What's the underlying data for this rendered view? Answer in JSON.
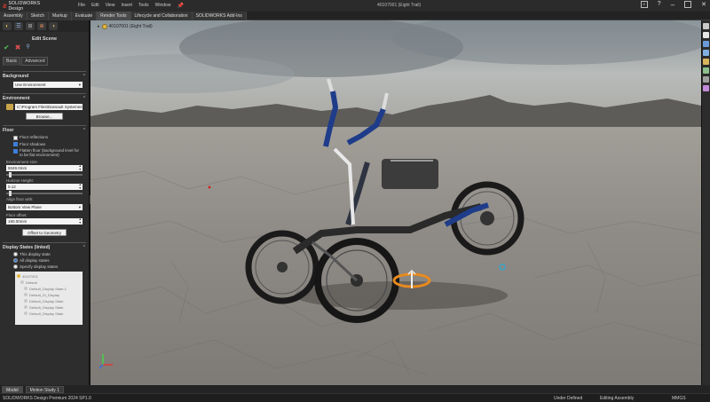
{
  "titlebar": {
    "product": "SOLIDWORKS Design",
    "menus": [
      "File",
      "Edit",
      "View",
      "Insert",
      "Tools",
      "Window"
    ],
    "document": "40107001 (Eight Trail)"
  },
  "command_tabs": [
    "Assembly",
    "Sketch",
    "Markup",
    "Evaluate",
    "Render Tools",
    "Lifecycle and Collaboration",
    "SOLIDWORKS Add-Ins"
  ],
  "active_command_tab": "Render Tools",
  "property_manager": {
    "title": "Edit Scene",
    "tabs": [
      "Basic",
      "Advanced"
    ],
    "background": {
      "header": "Background",
      "value": "Use Environment"
    },
    "environment": {
      "header": "Environment",
      "path": "C:\\Program Files\\Dassault Systemes",
      "browse_label": "Browse..."
    },
    "floor": {
      "header": "Floor",
      "options": [
        {
          "label": "Floor reflections",
          "checked": false
        },
        {
          "label": "Floor shadows",
          "checked": true
        },
        {
          "label": "Flatten floor (background level for to be flat environment)",
          "checked": true
        }
      ],
      "env_size_label": "Environment size:",
      "env_size": "5049.0mm",
      "horizon_label": "Horizon Height:",
      "horizon": "0.12",
      "align_label": "Align floor with:",
      "align": "Bottom View Plane",
      "offset_label": "Floor offset:",
      "offset": "190.00mm",
      "offset_button": "Offset to Geometry"
    },
    "display_states": {
      "header": "Display States (linked)",
      "options": [
        {
          "label": "This display state",
          "checked": false
        },
        {
          "label": "All display states",
          "checked": true
        },
        {
          "label": "Specify display states",
          "checked": false
        }
      ],
      "items": [
        "40107001",
        "Default",
        "Default_Display State-1",
        "Default_Di_Display",
        "Default_Display State",
        "Default_Display State",
        "Default_Display State"
      ]
    }
  },
  "viewport": {
    "tree_root": "40107001 (Eight Trail)"
  },
  "bottom_tabs": [
    "Model",
    "Motion Study 1"
  ],
  "active_bottom_tab": "Model",
  "status": {
    "product": "SOLIDWORKS Design Premium 2024 SP1.0",
    "definition": "Under Defined",
    "editing": "Editing Assembly",
    "units": "MMGS"
  },
  "colors": {
    "accent": "#3f7ed8",
    "frame_blue": "#1e3c8a",
    "brand_red": "#e23b2e",
    "ring_orange": "#e88a1f"
  }
}
